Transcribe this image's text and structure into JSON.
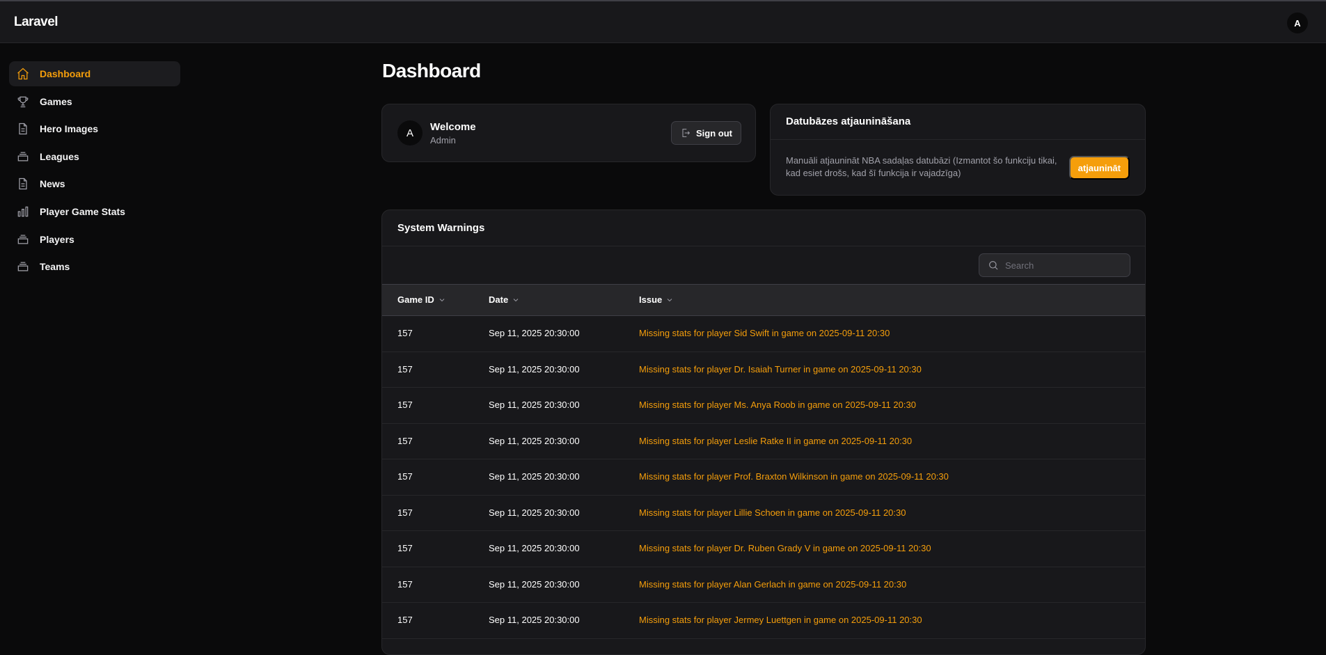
{
  "app": {
    "brand": "Laravel",
    "user_initial": "A"
  },
  "sidebar": {
    "items": [
      {
        "label": "Dashboard",
        "icon": "home-icon",
        "active": true
      },
      {
        "label": "Games",
        "icon": "trophy-icon"
      },
      {
        "label": "Hero Images",
        "icon": "document-icon"
      },
      {
        "label": "Leagues",
        "icon": "inbox-stack-icon"
      },
      {
        "label": "News",
        "icon": "document-icon"
      },
      {
        "label": "Player Game Stats",
        "icon": "bar-chart-icon"
      },
      {
        "label": "Players",
        "icon": "inbox-stack-icon"
      },
      {
        "label": "Teams",
        "icon": "inbox-stack-icon"
      }
    ]
  },
  "page": {
    "title": "Dashboard"
  },
  "welcome": {
    "avatar_initial": "A",
    "title": "Welcome",
    "subtitle": "Admin",
    "signout_label": "Sign out"
  },
  "db_update": {
    "title": "Datubāzes atjaunināšana",
    "description": "Manuāli atjaunināt NBA sadaļas datubāzi (Izmantot šo funkciju tikai, kad esiet drošs, kad šī funkcija ir vajadzīga)",
    "button_label": "atjaunināt"
  },
  "warnings": {
    "title": "System Warnings",
    "search_placeholder": "Search",
    "columns": [
      "Game ID",
      "Date",
      "Issue"
    ],
    "rows": [
      {
        "game_id": "157",
        "date": "Sep 11, 2025 20:30:00",
        "issue": "Missing stats for player Sid Swift in game on 2025-09-11 20:30"
      },
      {
        "game_id": "157",
        "date": "Sep 11, 2025 20:30:00",
        "issue": "Missing stats for player Dr. Isaiah Turner in game on 2025-09-11 20:30"
      },
      {
        "game_id": "157",
        "date": "Sep 11, 2025 20:30:00",
        "issue": "Missing stats for player Ms. Anya Roob in game on 2025-09-11 20:30"
      },
      {
        "game_id": "157",
        "date": "Sep 11, 2025 20:30:00",
        "issue": "Missing stats for player Leslie Ratke II in game on 2025-09-11 20:30"
      },
      {
        "game_id": "157",
        "date": "Sep 11, 2025 20:30:00",
        "issue": "Missing stats for player Prof. Braxton Wilkinson in game on 2025-09-11 20:30"
      },
      {
        "game_id": "157",
        "date": "Sep 11, 2025 20:30:00",
        "issue": "Missing stats for player Lillie Schoen in game on 2025-09-11 20:30"
      },
      {
        "game_id": "157",
        "date": "Sep 11, 2025 20:30:00",
        "issue": "Missing stats for player Dr. Ruben Grady V in game on 2025-09-11 20:30"
      },
      {
        "game_id": "157",
        "date": "Sep 11, 2025 20:30:00",
        "issue": "Missing stats for player Alan Gerlach in game on 2025-09-11 20:30"
      },
      {
        "game_id": "157",
        "date": "Sep 11, 2025 20:30:00",
        "issue": "Missing stats for player Jermey Luettgen in game on 2025-09-11 20:30"
      }
    ]
  },
  "colors": {
    "accent": "#f59e0b",
    "background": "#0a0a0b",
    "surface": "#18181b",
    "border": "#27272a"
  }
}
